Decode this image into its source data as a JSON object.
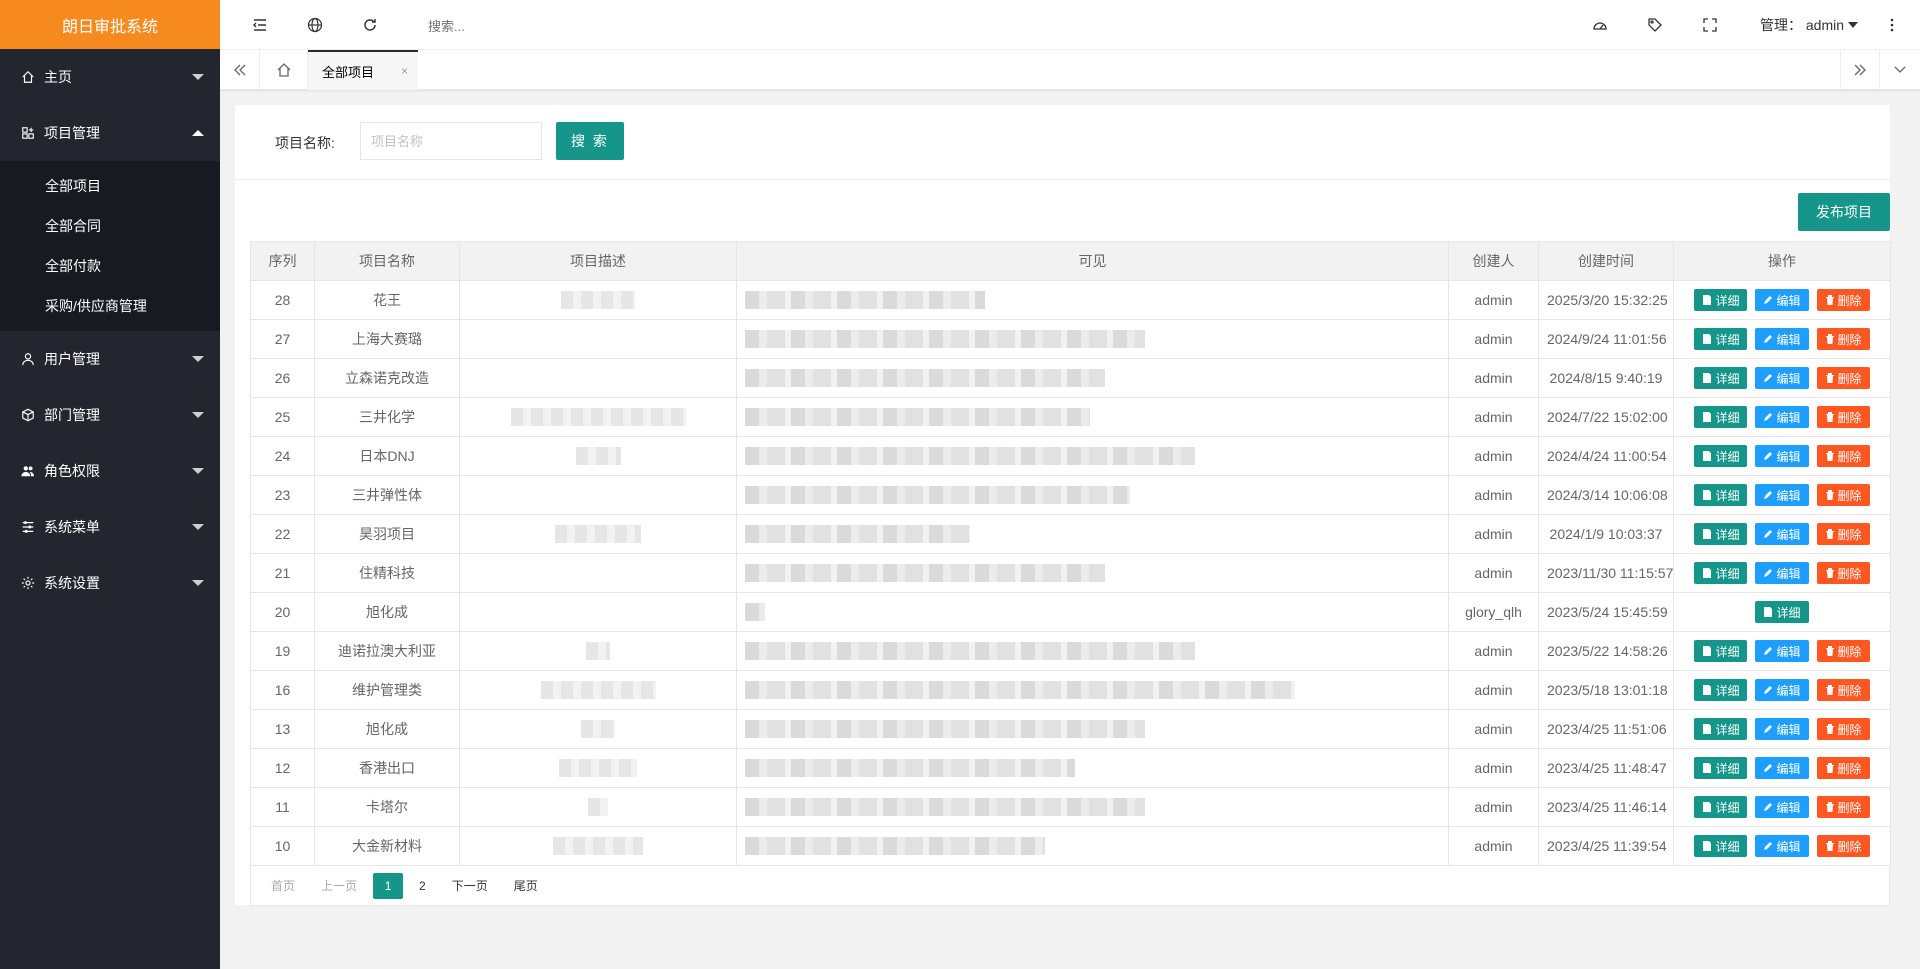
{
  "app": {
    "title": "朗日审批系统"
  },
  "sidebar": {
    "items": [
      {
        "label": "主页",
        "icon": "home-icon",
        "open": false
      },
      {
        "label": "项目管理",
        "icon": "apps-icon",
        "open": true,
        "children": [
          "全部项目",
          "全部合同",
          "全部付款",
          "采购/供应商管理"
        ]
      },
      {
        "label": "用户管理",
        "icon": "user-icon",
        "open": false
      },
      {
        "label": "部门管理",
        "icon": "box-icon",
        "open": false
      },
      {
        "label": "角色权限",
        "icon": "users-icon",
        "open": false
      },
      {
        "label": "系统菜单",
        "icon": "menu-icon",
        "open": false
      },
      {
        "label": "系统设置",
        "icon": "gear-icon",
        "open": false
      }
    ]
  },
  "header": {
    "search_placeholder": "搜索...",
    "user_label": "管理： admin"
  },
  "tabs": {
    "active_label": "全部项目",
    "close_glyph": "×"
  },
  "filter": {
    "label": "项目名称:",
    "placeholder": "项目名称",
    "search_button": "搜 索",
    "publish_button": "发布项目"
  },
  "table": {
    "columns": [
      "序列",
      "项目名称",
      "项目描述",
      "可见",
      "创建人",
      "创建时间",
      "操作"
    ],
    "action_labels": {
      "detail": "详细",
      "edit": "编辑",
      "delete": "删除"
    },
    "rows": [
      {
        "id": "28",
        "name": "花王",
        "desc": "",
        "creator": "admin",
        "time": "2025/3/20 15:32:25",
        "actions": "full"
      },
      {
        "id": "27",
        "name": "上海大赛璐",
        "desc": "",
        "creator": "admin",
        "time": "2024/9/24 11:01:56",
        "actions": "full"
      },
      {
        "id": "26",
        "name": "立森诺克改造",
        "desc": "",
        "creator": "admin",
        "time": "2024/8/15 9:40:19",
        "actions": "full"
      },
      {
        "id": "25",
        "name": "三井化学",
        "desc": "",
        "creator": "admin",
        "time": "2024/7/22 15:02:00",
        "actions": "full"
      },
      {
        "id": "24",
        "name": "日本DNJ",
        "desc": "",
        "creator": "admin",
        "time": "2024/4/24 11:00:54",
        "actions": "full"
      },
      {
        "id": "23",
        "name": "三井弹性体",
        "desc": "",
        "creator": "admin",
        "time": "2024/3/14 10:06:08",
        "actions": "full"
      },
      {
        "id": "22",
        "name": "昊羽项目",
        "desc": "",
        "creator": "admin",
        "time": "2024/1/9 10:03:37",
        "actions": "full"
      },
      {
        "id": "21",
        "name": "住精科技",
        "desc": "",
        "creator": "admin",
        "time": "2023/11/30 11:15:57",
        "actions": "full"
      },
      {
        "id": "20",
        "name": "旭化成",
        "desc": "",
        "creator": "glory_qlh",
        "time": "2023/5/24 15:45:59",
        "actions": "detail"
      },
      {
        "id": "19",
        "name": "迪诺拉澳大利亚",
        "desc": "",
        "creator": "admin",
        "time": "2023/5/22 14:58:26",
        "actions": "full"
      },
      {
        "id": "16",
        "name": "维护管理类",
        "desc": "",
        "creator": "admin",
        "time": "2023/5/18 13:01:18",
        "actions": "full"
      },
      {
        "id": "13",
        "name": "旭化成",
        "desc": "",
        "creator": "admin",
        "time": "2023/4/25 11:51:06",
        "actions": "full"
      },
      {
        "id": "12",
        "name": "香港出口",
        "desc": "",
        "creator": "admin",
        "time": "2023/4/25 11:48:47",
        "actions": "full"
      },
      {
        "id": "11",
        "name": "卡塔尔",
        "desc": "",
        "creator": "admin",
        "time": "2023/4/25 11:46:14",
        "actions": "full"
      },
      {
        "id": "10",
        "name": "大金新材料",
        "desc": "",
        "creator": "admin",
        "time": "2023/4/25 11:39:54",
        "actions": "full"
      }
    ]
  },
  "pagination": {
    "first": "首页",
    "prev": "上一页",
    "pages": [
      "1",
      "2"
    ],
    "current": "1",
    "next": "下一页",
    "last": "尾页"
  },
  "colors": {
    "sidebar_bg": "#23262e",
    "brand_orange": "#f68a1f",
    "primary_teal": "#16968a",
    "edit_blue": "#1e9fff",
    "delete_red": "#ff5722"
  }
}
